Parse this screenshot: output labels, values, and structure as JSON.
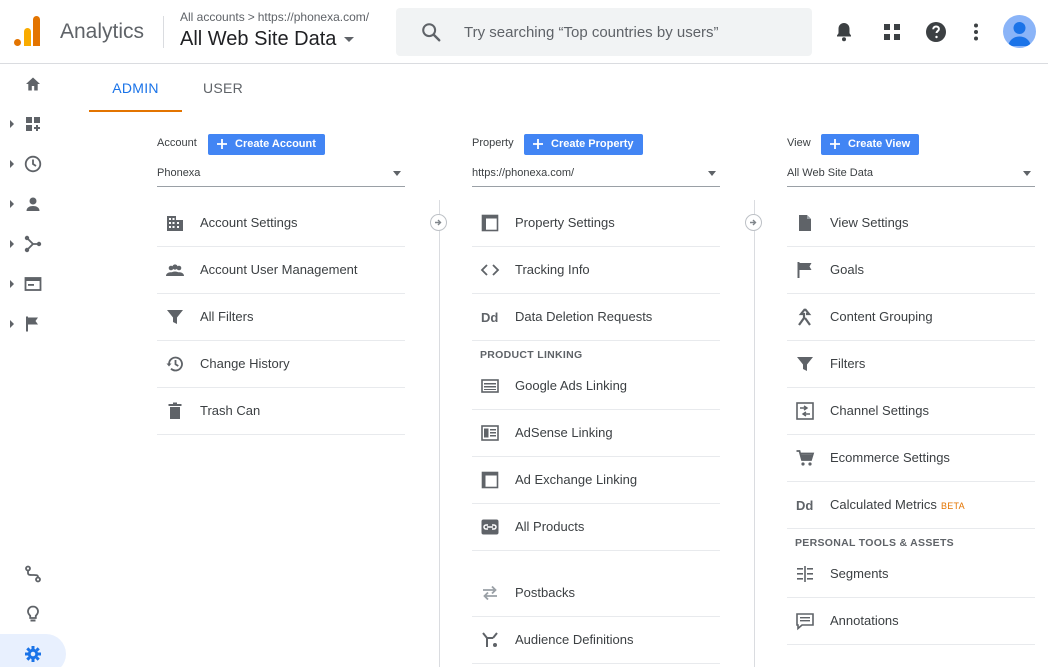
{
  "header": {
    "app_name": "Analytics",
    "crumb_root": "All accounts",
    "crumb_sep": ">",
    "crumb_property": "https://phonexa.com/",
    "view_title": "All Web Site Data",
    "search_placeholder": "Try searching “Top countries by users”"
  },
  "colors": {
    "primary": "#4285f4",
    "accent": "#e37400",
    "tab_active": "#1a73e8",
    "logo_light": "#f9ab00"
  },
  "leftnav": {
    "items": [
      {
        "icon": "home-icon"
      },
      {
        "icon": "customization-icon"
      },
      {
        "icon": "realtime-clock-icon"
      },
      {
        "icon": "audience-person-icon"
      },
      {
        "icon": "acquisition-icon"
      },
      {
        "icon": "behavior-icon"
      },
      {
        "icon": "conversions-flag-icon"
      },
      {
        "icon": "attribution-icon"
      },
      {
        "icon": "discover-lightbulb-icon"
      },
      {
        "icon": "admin-gear-icon"
      }
    ]
  },
  "tabs": [
    {
      "label": "ADMIN",
      "active": true
    },
    {
      "label": "USER",
      "active": false
    }
  ],
  "account": {
    "label": "Account",
    "create_label": "Create Account",
    "selected": "Phonexa",
    "items": [
      {
        "icon": "building-icon",
        "label": "Account Settings"
      },
      {
        "icon": "people-icon",
        "label": "Account User Management"
      },
      {
        "icon": "filter-icon",
        "label": "All Filters"
      },
      {
        "icon": "history-icon",
        "label": "Change History"
      },
      {
        "icon": "trash-icon",
        "label": "Trash Can"
      }
    ]
  },
  "property": {
    "label": "Property",
    "create_label": "Create Property",
    "selected": "https://phonexa.com/",
    "items": [
      {
        "icon": "window-icon",
        "label": "Property Settings"
      },
      {
        "icon": "code-icon",
        "label": "Tracking Info"
      },
      {
        "icon": "dd-icon",
        "label": "Data Deletion Requests"
      }
    ],
    "section": "PRODUCT LINKING",
    "linking": [
      {
        "icon": "ads-icon",
        "label": "Google Ads Linking"
      },
      {
        "icon": "adsense-icon",
        "label": "AdSense Linking"
      },
      {
        "icon": "adexchange-icon",
        "label": "Ad Exchange Linking"
      },
      {
        "icon": "link-icon",
        "label": "All Products"
      }
    ],
    "more": [
      {
        "icon": "postbacks-icon",
        "label": "Postbacks"
      },
      {
        "icon": "audience-def-icon",
        "label": "Audience Definitions"
      }
    ]
  },
  "view": {
    "label": "View",
    "create_label": "Create View",
    "selected": "All Web Site Data",
    "items": [
      {
        "icon": "document-icon",
        "label": "View Settings"
      },
      {
        "icon": "flag-icon",
        "label": "Goals"
      },
      {
        "icon": "grouping-icon",
        "label": "Content Grouping"
      },
      {
        "icon": "filter-icon",
        "label": "Filters"
      },
      {
        "icon": "channel-icon",
        "label": "Channel Settings"
      },
      {
        "icon": "cart-icon",
        "label": "Ecommerce Settings"
      },
      {
        "icon": "dd-icon",
        "label": "Calculated Metrics",
        "badge": "BETA"
      }
    ],
    "section": "PERSONAL TOOLS & ASSETS",
    "tools": [
      {
        "icon": "segments-icon",
        "label": "Segments"
      },
      {
        "icon": "annotations-icon",
        "label": "Annotations"
      }
    ]
  }
}
